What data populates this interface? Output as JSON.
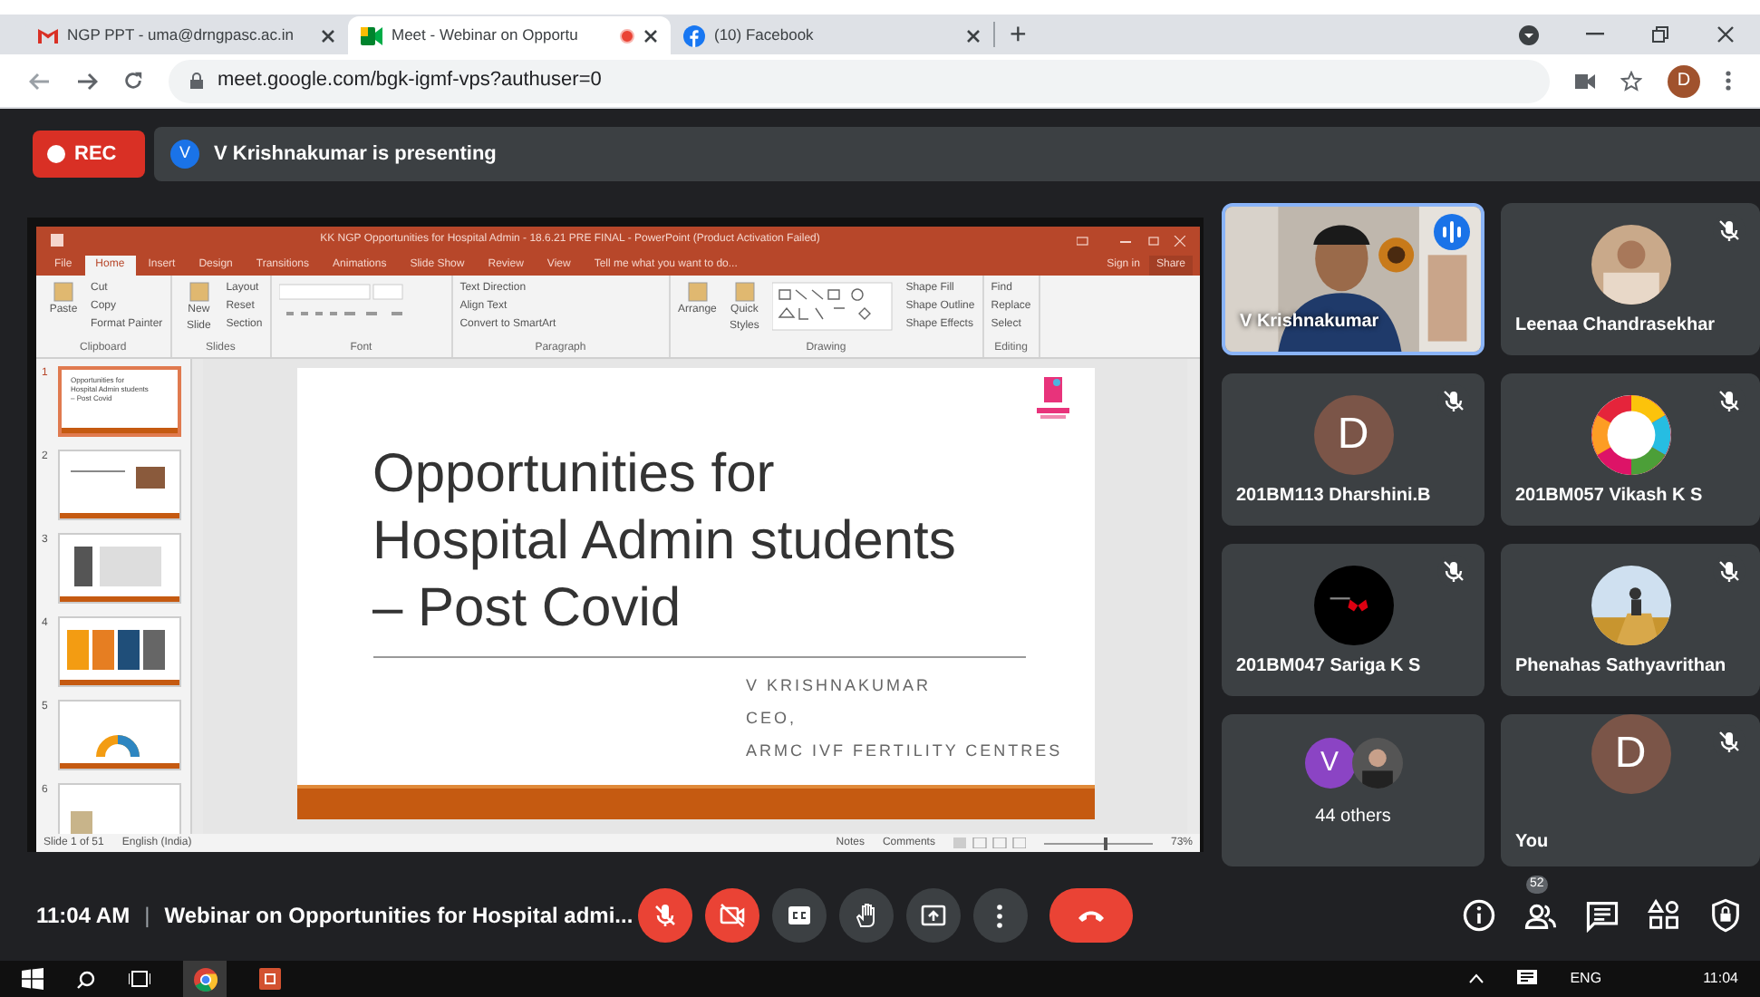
{
  "browser": {
    "tabs": [
      {
        "title": "NGP PPT - uma@drngpasc.ac.in",
        "selected": false,
        "recording": false
      },
      {
        "title": "Meet - Webinar on Opportu",
        "selected": true,
        "recording": true
      },
      {
        "title": "(10) Facebook",
        "selected": false,
        "recording": false
      }
    ],
    "new_tab": "+",
    "url": "meet.google.com/bgk-igmf-vps?authuser=0",
    "profile": "D"
  },
  "meeting": {
    "rec": "REC",
    "presenter_avatar": "V",
    "presenting": "V Krishnakumar is presenting"
  },
  "presentation": {
    "title": "KK NGP Opportunities for Hospital Admin - 18.6.21 PRE FINAL - PowerPoint (Product Activation Failed)",
    "ribbon_tabs": [
      {
        "label": "File",
        "selected": false
      },
      {
        "label": "Home",
        "selected": true
      },
      {
        "label": "Insert",
        "selected": false
      },
      {
        "label": "Design",
        "selected": false
      },
      {
        "label": "Transitions",
        "selected": false
      },
      {
        "label": "Animations",
        "selected": false
      },
      {
        "label": "Slide Show",
        "selected": false
      },
      {
        "label": "Review",
        "selected": false
      },
      {
        "label": "View",
        "selected": false
      }
    ],
    "tell_me": "Tell me what you want to do...",
    "sign_in": "Sign in",
    "share": "Share",
    "groups": [
      {
        "label": "Clipboard",
        "large": [
          "Paste"
        ],
        "small": [
          "Cut",
          "Copy",
          "Format Painter"
        ]
      },
      {
        "label": "Slides",
        "large": [
          "New Slide"
        ],
        "small": [
          "Layout",
          "Reset",
          "Section"
        ]
      },
      {
        "label": "Font"
      },
      {
        "label": "Paragraph",
        "small": [
          "Text Direction",
          "Align Text",
          "Convert to SmartArt"
        ]
      },
      {
        "label": "Drawing",
        "large": [
          "Arrange",
          "Quick Styles"
        ],
        "small": [
          "Shape Fill",
          "Shape Outline",
          "Shape Effects"
        ]
      },
      {
        "label": "Editing",
        "small": [
          "Find",
          "Replace",
          "Select"
        ]
      }
    ],
    "thumbnails": [
      {
        "number": "1",
        "selected": true,
        "lines": [
          "Opportunities for",
          "Hospital Admin students",
          "– Post Covid"
        ]
      },
      {
        "number": "2",
        "selected": false
      },
      {
        "number": "3",
        "selected": false
      },
      {
        "number": "4",
        "selected": false
      },
      {
        "number": "5",
        "selected": false
      },
      {
        "number": "6",
        "selected": false
      }
    ],
    "slide": {
      "title": [
        "Opportunities for",
        "Hospital Admin students",
        "– Post Covid"
      ],
      "subtitle": [
        "V KRISHNAKUMAR",
        "CEO,",
        "ARMC IVF FERTILITY CENTRES"
      ]
    },
    "status": {
      "slide": "Slide 1 of 51",
      "language": "English (India)",
      "notes": "Notes",
      "comments": "Comments",
      "zoom": "73%",
      "zoom_slider": {
        "level": 0.55
      }
    }
  },
  "tiles": [
    {
      "name": "V Krishnakumar",
      "kind": "video",
      "muted": false,
      "speaking": true
    },
    {
      "name": "Leenaa Chandrasekhar",
      "muted": true,
      "speaking": false
    },
    {
      "name": "201BM113 Dharshini.B",
      "kind": "letter",
      "letter": "D",
      "color": "#7b5548",
      "muted": true,
      "speaking": false
    },
    {
      "name": "201BM057 Vikash K S",
      "muted": true,
      "speaking": false
    },
    {
      "name": "201BM047 Sariga K S",
      "muted": true,
      "speaking": false
    },
    {
      "name": "Phenahas Sathyavrithan",
      "muted": true,
      "speaking": false
    },
    {
      "name": "44 others",
      "kind": "others",
      "letter": "V",
      "color": "#8b44c4",
      "muted": false,
      "speaking": false
    },
    {
      "name": "You",
      "kind": "letter",
      "letter": "D",
      "color": "#7b5548",
      "muted": true,
      "speaking": false
    }
  ],
  "bottom_bar": {
    "time": "11:04 AM",
    "separator": "|",
    "title": "Webinar on Opportunities for Hospital admi...",
    "controls": [
      {
        "kind": "mic",
        "off": true
      },
      {
        "kind": "camera",
        "off": true
      },
      {
        "kind": "captions",
        "off": false
      },
      {
        "kind": "hand",
        "off": false
      },
      {
        "kind": "present",
        "off": false
      },
      {
        "kind": "more",
        "off": false
      },
      {
        "kind": "leave",
        "off": true
      }
    ],
    "side": [
      {
        "kind": "info"
      },
      {
        "kind": "people",
        "badge": "52"
      },
      {
        "kind": "chat"
      },
      {
        "kind": "activities"
      },
      {
        "kind": "lock"
      }
    ]
  },
  "taskbar": {
    "language": "ENG",
    "time": "11:04"
  }
}
